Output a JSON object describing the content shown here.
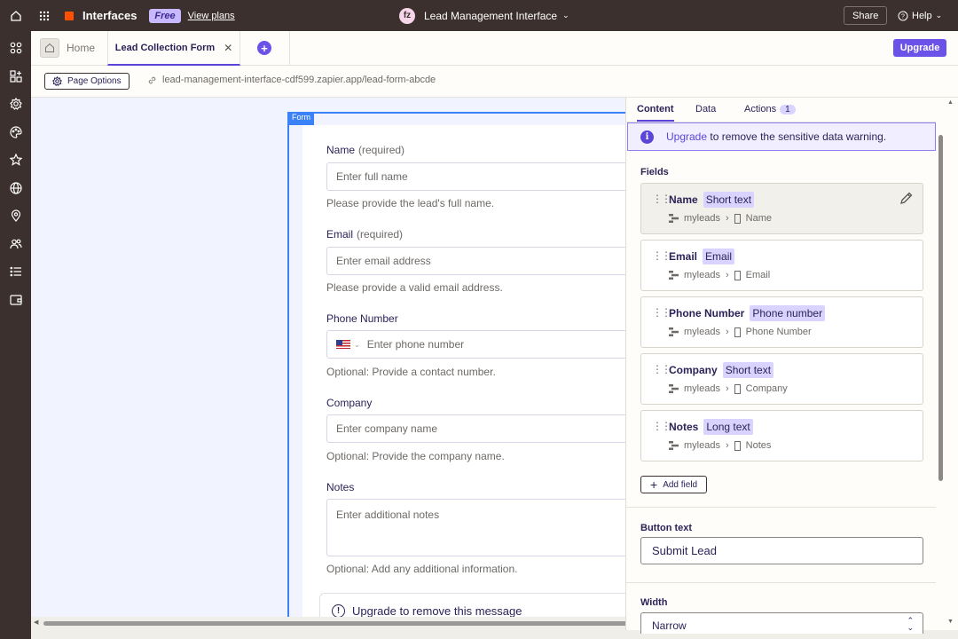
{
  "topbar": {
    "app_name": "Interfaces",
    "plan_badge": "Free",
    "view_plans": "View plans",
    "avatar_initials": "fz",
    "project_title": "Lead Management Interface",
    "share_label": "Share",
    "help_label": "Help"
  },
  "tabs": {
    "home_label": "Home",
    "active_label": "Lead Collection Form",
    "upgrade_label": "Upgrade"
  },
  "urlbar": {
    "page_options": "Page Options",
    "url": "lead-management-interface-cdf599.zapier.app/lead-form-abcde"
  },
  "form": {
    "tag": "Form",
    "required_text": "(required)",
    "fields": [
      {
        "label": "Name",
        "placeholder": "Enter full name",
        "help": "Please provide the lead's full name."
      },
      {
        "label": "Email",
        "placeholder": "Enter email address",
        "help": "Please provide a valid email address."
      },
      {
        "label": "Phone Number",
        "placeholder": "Enter phone number",
        "help": "Optional: Provide a contact number."
      },
      {
        "label": "Company",
        "placeholder": "Enter company name",
        "help": "Optional: Provide the company name."
      },
      {
        "label": "Notes",
        "placeholder": "Enter additional notes",
        "help": "Optional: Add any additional information."
      }
    ],
    "upgrade_message": "Upgrade to remove this message"
  },
  "panel": {
    "tabs": {
      "content": "Content",
      "data": "Data",
      "actions": "Actions",
      "actions_count": "1"
    },
    "warning": {
      "link": "Upgrade",
      "text": "to remove the sensitive data warning."
    },
    "fields_title": "Fields",
    "fields": [
      {
        "name": "Name",
        "type": "Short text",
        "table": "myleads",
        "column": "Name"
      },
      {
        "name": "Email",
        "type": "Email",
        "table": "myleads",
        "column": "Email"
      },
      {
        "name": "Phone Number",
        "type": "Phone number",
        "table": "myleads",
        "column": "Phone Number"
      },
      {
        "name": "Company",
        "type": "Short text",
        "table": "myleads",
        "column": "Company"
      },
      {
        "name": "Notes",
        "type": "Long text",
        "table": "myleads",
        "column": "Notes"
      }
    ],
    "add_field": "Add field",
    "button_text_label": "Button text",
    "button_text_value": "Submit Lead",
    "width_label": "Width",
    "width_value": "Narrow"
  },
  "colors": {
    "accent": "#6b52e8",
    "topbar": "#3b302d",
    "form_outline": "#3b82f6",
    "chip": "#d9d4ff"
  }
}
